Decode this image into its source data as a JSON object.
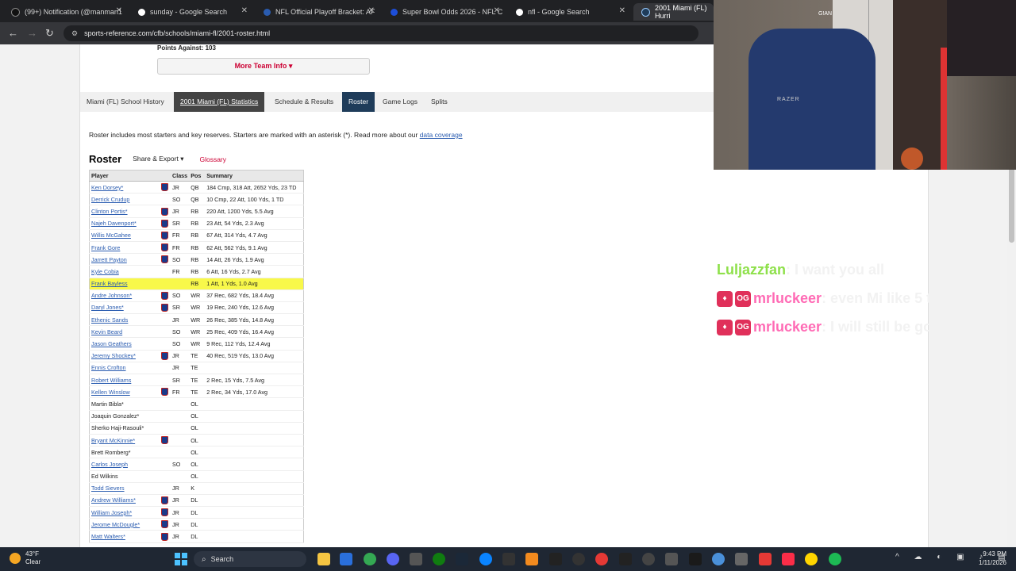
{
  "browser": {
    "tabs": [
      {
        "label": "(99+) Notification (@manman1",
        "color": "#111111"
      },
      {
        "label": "sunday - Google Search",
        "color": "#4285f4"
      },
      {
        "label": "NFL Official Playoff Bracket: AF",
        "color": "#013369"
      },
      {
        "label": "Super Bowl Odds 2026 - NFL C",
        "color": "#1d4ed8"
      },
      {
        "label": "nfl - Google Search",
        "color": "#4285f4"
      },
      {
        "label": "2001 Miami (FL) Hurri",
        "color": "#1f3c5a"
      }
    ],
    "url": "sports-reference.com/cfb/schools/miami-fl/2001-roster.html"
  },
  "page": {
    "points_against": "Points Against: 103",
    "more_team_info": "More Team Info ▾",
    "subnav": [
      "Miami (FL) School History",
      "2001 Miami (FL) Statistics",
      "Schedule & Results",
      "Roster",
      "Game Logs",
      "Splits"
    ],
    "note_text": "Roster includes most starters and key reserves. Starters are marked with an asterisk (*). Read more about our",
    "note_link": "data coverage",
    "roster_title": "Roster",
    "share_export": "Share & Export ▾",
    "glossary": "Glossary",
    "columns": [
      "Player",
      "Class",
      "Pos",
      "Summary"
    ]
  },
  "roster": [
    {
      "player": "Ken Dorsey*",
      "nfl": true,
      "class": "JR",
      "pos": "QB",
      "summary": "184 Cmp, 318 Att, 2652 Yds, 23 TD",
      "link": true
    },
    {
      "player": "Derrick Crudup",
      "nfl": false,
      "class": "SO",
      "pos": "QB",
      "summary": "10 Cmp, 22 Att, 100 Yds, 1 TD",
      "link": true
    },
    {
      "player": "Clinton Portis*",
      "nfl": true,
      "class": "JR",
      "pos": "RB",
      "summary": "220 Att, 1200 Yds, 5.5 Avg",
      "link": true
    },
    {
      "player": "Najeh Davenport*",
      "nfl": true,
      "class": "SR",
      "pos": "RB",
      "summary": "23 Att, 54 Yds, 2.3 Avg",
      "link": true
    },
    {
      "player": "Willis McGahee",
      "nfl": true,
      "class": "FR",
      "pos": "RB",
      "summary": "67 Att, 314 Yds, 4.7 Avg",
      "link": true
    },
    {
      "player": "Frank Gore",
      "nfl": true,
      "class": "FR",
      "pos": "RB",
      "summary": "62 Att, 562 Yds, 9.1 Avg",
      "link": true
    },
    {
      "player": "Jarrett Payton",
      "nfl": true,
      "class": "SO",
      "pos": "RB",
      "summary": "14 Att, 26 Yds, 1.9 Avg",
      "link": true
    },
    {
      "player": "Kyle Cobia",
      "nfl": false,
      "class": "FR",
      "pos": "RB",
      "summary": "6 Att, 16 Yds, 2.7 Avg",
      "link": true
    },
    {
      "player": "Frank Bayless",
      "nfl": false,
      "class": "",
      "pos": "RB",
      "summary": "1 Att, 1 Yds, 1.0 Avg",
      "link": true,
      "highlight": true
    },
    {
      "player": "Andre Johnson*",
      "nfl": true,
      "class": "SO",
      "pos": "WR",
      "summary": "37 Rec, 682 Yds, 18.4 Avg",
      "link": true
    },
    {
      "player": "Daryl Jones*",
      "nfl": true,
      "class": "SR",
      "pos": "WR",
      "summary": "19 Rec, 240 Yds, 12.6 Avg",
      "link": true
    },
    {
      "player": "Ethenic Sands",
      "nfl": false,
      "class": "JR",
      "pos": "WR",
      "summary": "26 Rec, 385 Yds, 14.8 Avg",
      "link": true
    },
    {
      "player": "Kevin Beard",
      "nfl": false,
      "class": "SO",
      "pos": "WR",
      "summary": "25 Rec, 409 Yds, 16.4 Avg",
      "link": true
    },
    {
      "player": "Jason Geathers",
      "nfl": false,
      "class": "SO",
      "pos": "WR",
      "summary": "9 Rec, 112 Yds, 12.4 Avg",
      "link": true
    },
    {
      "player": "Jeremy Shockey*",
      "nfl": true,
      "class": "JR",
      "pos": "TE",
      "summary": "40 Rec, 519 Yds, 13.0 Avg",
      "link": true
    },
    {
      "player": "Ennis Crofton",
      "nfl": false,
      "class": "JR",
      "pos": "TE",
      "summary": "",
      "link": true
    },
    {
      "player": "Robert Williams",
      "nfl": false,
      "class": "SR",
      "pos": "TE",
      "summary": "2 Rec, 15 Yds, 7.5 Avg",
      "link": true
    },
    {
      "player": "Kellen Winslow",
      "nfl": true,
      "class": "FR",
      "pos": "TE",
      "summary": "2 Rec, 34 Yds, 17.0 Avg",
      "link": true
    },
    {
      "player": "Martin Bibla*",
      "nfl": false,
      "class": "",
      "pos": "OL",
      "summary": "",
      "link": false
    },
    {
      "player": "Joaquin Gonzalez*",
      "nfl": false,
      "class": "",
      "pos": "OL",
      "summary": "",
      "link": false
    },
    {
      "player": "Sherko Haji-Rasouli*",
      "nfl": false,
      "class": "",
      "pos": "OL",
      "summary": "",
      "link": false
    },
    {
      "player": "Bryant McKinnie*",
      "nfl": true,
      "class": "",
      "pos": "OL",
      "summary": "",
      "link": true
    },
    {
      "player": "Brett Romberg*",
      "nfl": false,
      "class": "",
      "pos": "OL",
      "summary": "",
      "link": false
    },
    {
      "player": "Carlos Joseph",
      "nfl": false,
      "class": "SO",
      "pos": "OL",
      "summary": "",
      "link": true
    },
    {
      "player": "Ed Wilkins",
      "nfl": false,
      "class": "",
      "pos": "OL",
      "summary": "",
      "link": false
    },
    {
      "player": "Todd Sievers",
      "nfl": false,
      "class": "JR",
      "pos": "K",
      "summary": "",
      "link": true
    },
    {
      "player": "Andrew Williams*",
      "nfl": true,
      "class": "JR",
      "pos": "DL",
      "summary": "",
      "link": true
    },
    {
      "player": "William Joseph*",
      "nfl": true,
      "class": "JR",
      "pos": "DL",
      "summary": "",
      "link": true
    },
    {
      "player": "Jerome McDougle*",
      "nfl": true,
      "class": "JR",
      "pos": "DL",
      "summary": "",
      "link": true
    },
    {
      "player": "Matt Walters*",
      "nfl": true,
      "class": "JR",
      "pos": "DL",
      "summary": "",
      "link": true
    }
  ],
  "webcam": {
    "logo": "G!AN",
    "chair_label": "RAZER"
  },
  "chat": [
    {
      "user": "Luljazzfan",
      "badges": [],
      "message": ": I want you all",
      "color": "#8ee04a"
    },
    {
      "user": "mrluckeer",
      "badges": [
        "gem",
        "OG"
      ],
      "message": ": even Mi like 5 times",
      "color": "#ff6bb5"
    },
    {
      "user": "mrluckeer",
      "badges": [
        "gem",
        "OG"
      ],
      "message": ": I will still be going",
      "color": "#ff6bb5"
    }
  ],
  "taskbar": {
    "weather_temp": "43°F",
    "weather_cond": "Clear",
    "search": "Search",
    "time": "9:43 PM",
    "date": "1/11/2026"
  }
}
